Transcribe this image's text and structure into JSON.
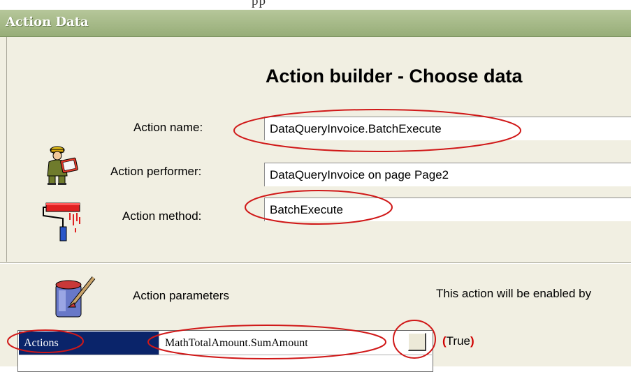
{
  "top_strip": {
    "text": "pp"
  },
  "window": {
    "title": "Action Data"
  },
  "builder": {
    "heading": "Action builder - Choose data",
    "action_name": {
      "label": "Action name:",
      "value": "DataQueryInvoice.BatchExecute"
    },
    "action_performer": {
      "label": "Action performer:",
      "value": "DataQueryInvoice on page Page2"
    },
    "action_method": {
      "label": "Action method:",
      "value": "BatchExecute"
    }
  },
  "parameters": {
    "label": "Action parameters",
    "enabled_text": "This action will be enabled by",
    "grid": {
      "key": "Actions",
      "value": "MathTotalAmount.SumAmount"
    },
    "condition": {
      "open": "(",
      "value": "True",
      "close": ")"
    }
  },
  "annotation_color": "#d01818",
  "icons": [
    "worker-reading-icon",
    "paint-roller-icon",
    "paint-bucket-icon",
    "ellipsis-button"
  ]
}
